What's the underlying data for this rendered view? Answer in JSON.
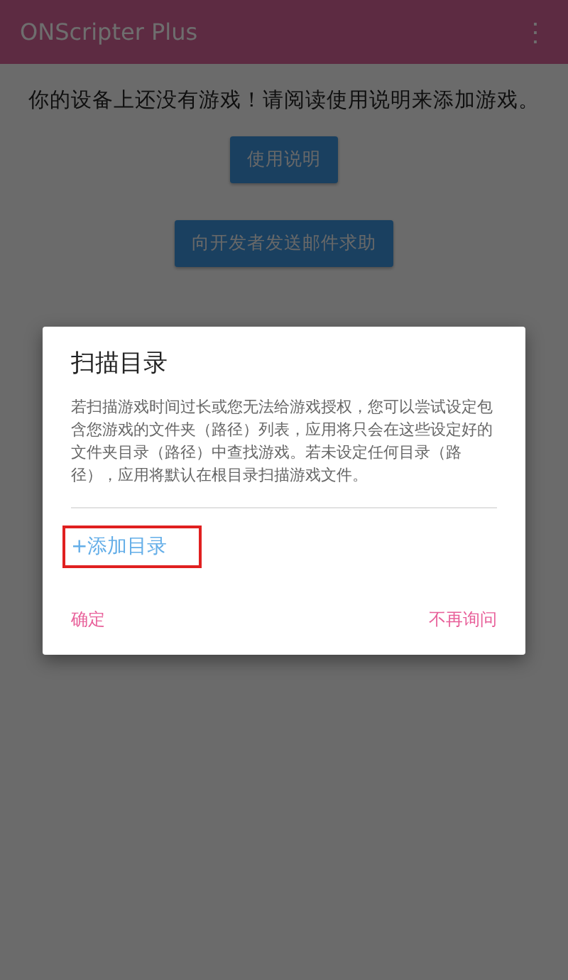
{
  "app_bar": {
    "title": "ONScripter Plus",
    "menu_icon": "⋮"
  },
  "empty_message": "你的设备上还没有游戏！请阅读使用说明来添加游戏。",
  "buttons": [
    "使用说明",
    "向开发者发送邮件求助"
  ],
  "dialog": {
    "title": "扫描目录",
    "body": "若扫描游戏时间过长或您无法给游戏授权，您可以尝试设定包含您游戏的文件夹（路径）列表，应用将只会在这些设定好的文件夹目录（路径）中查找游戏。若未设定任何目录（路径），应用将默认在根目录扫描游戏文件。",
    "add_link": {
      "label": "+添加目录",
      "highlighted": true
    },
    "actions": [
      "确定",
      "不再询问"
    ]
  }
}
